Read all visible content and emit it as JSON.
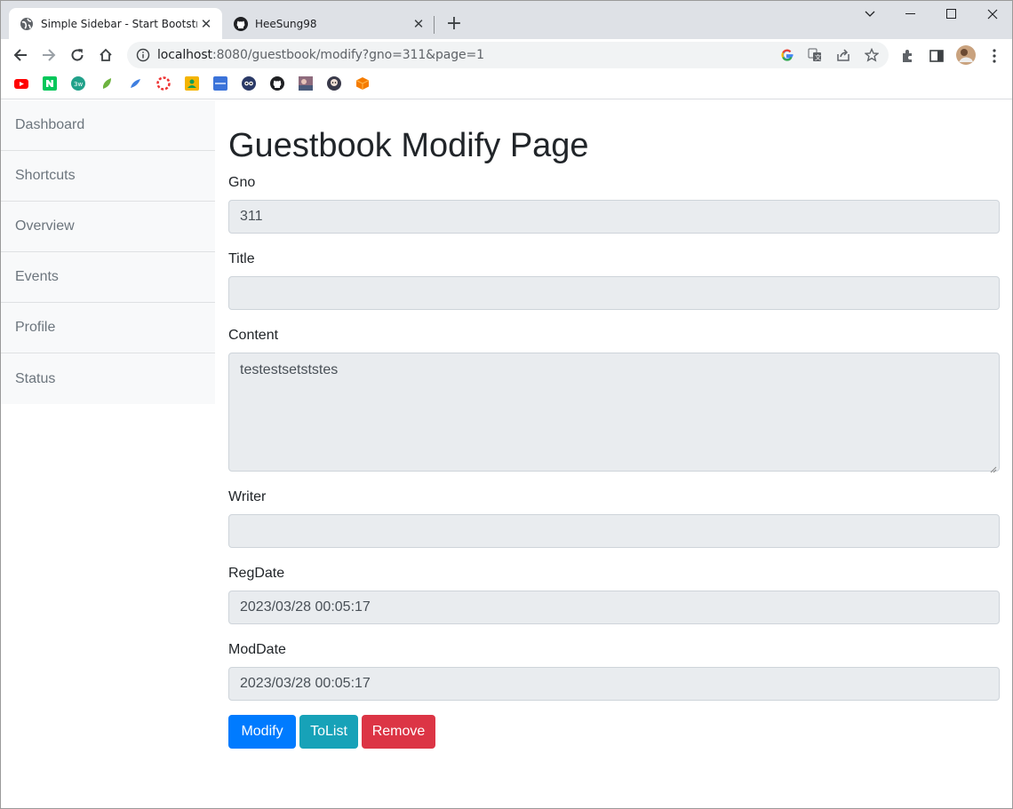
{
  "browser": {
    "tabs": [
      {
        "title": "Simple Sidebar - Start Bootstrap"
      },
      {
        "title": "HeeSung98"
      }
    ],
    "url_host": "localhost",
    "url_rest": ":8080/guestbook/modify?gno=311&page=1"
  },
  "sidebar": {
    "items": [
      {
        "label": "Dashboard"
      },
      {
        "label": "Shortcuts"
      },
      {
        "label": "Overview"
      },
      {
        "label": "Events"
      },
      {
        "label": "Profile"
      },
      {
        "label": "Status"
      }
    ]
  },
  "form": {
    "heading": "Guestbook Modify Page",
    "gno_label": "Gno",
    "gno_value": "311",
    "title_label": "Title",
    "title_value": "",
    "content_label": "Content",
    "content_value": "testestsetststes",
    "writer_label": "Writer",
    "writer_value": "",
    "regdate_label": "RegDate",
    "regdate_value": "2023/03/28 00:05:17",
    "moddate_label": "ModDate",
    "moddate_value": "2023/03/28 00:05:17"
  },
  "buttons": {
    "modify": "Modify",
    "tolist": "ToList",
    "remove": "Remove"
  },
  "colors": {
    "primary": "#007bff",
    "info": "#17a2b8",
    "danger": "#dc3545"
  }
}
